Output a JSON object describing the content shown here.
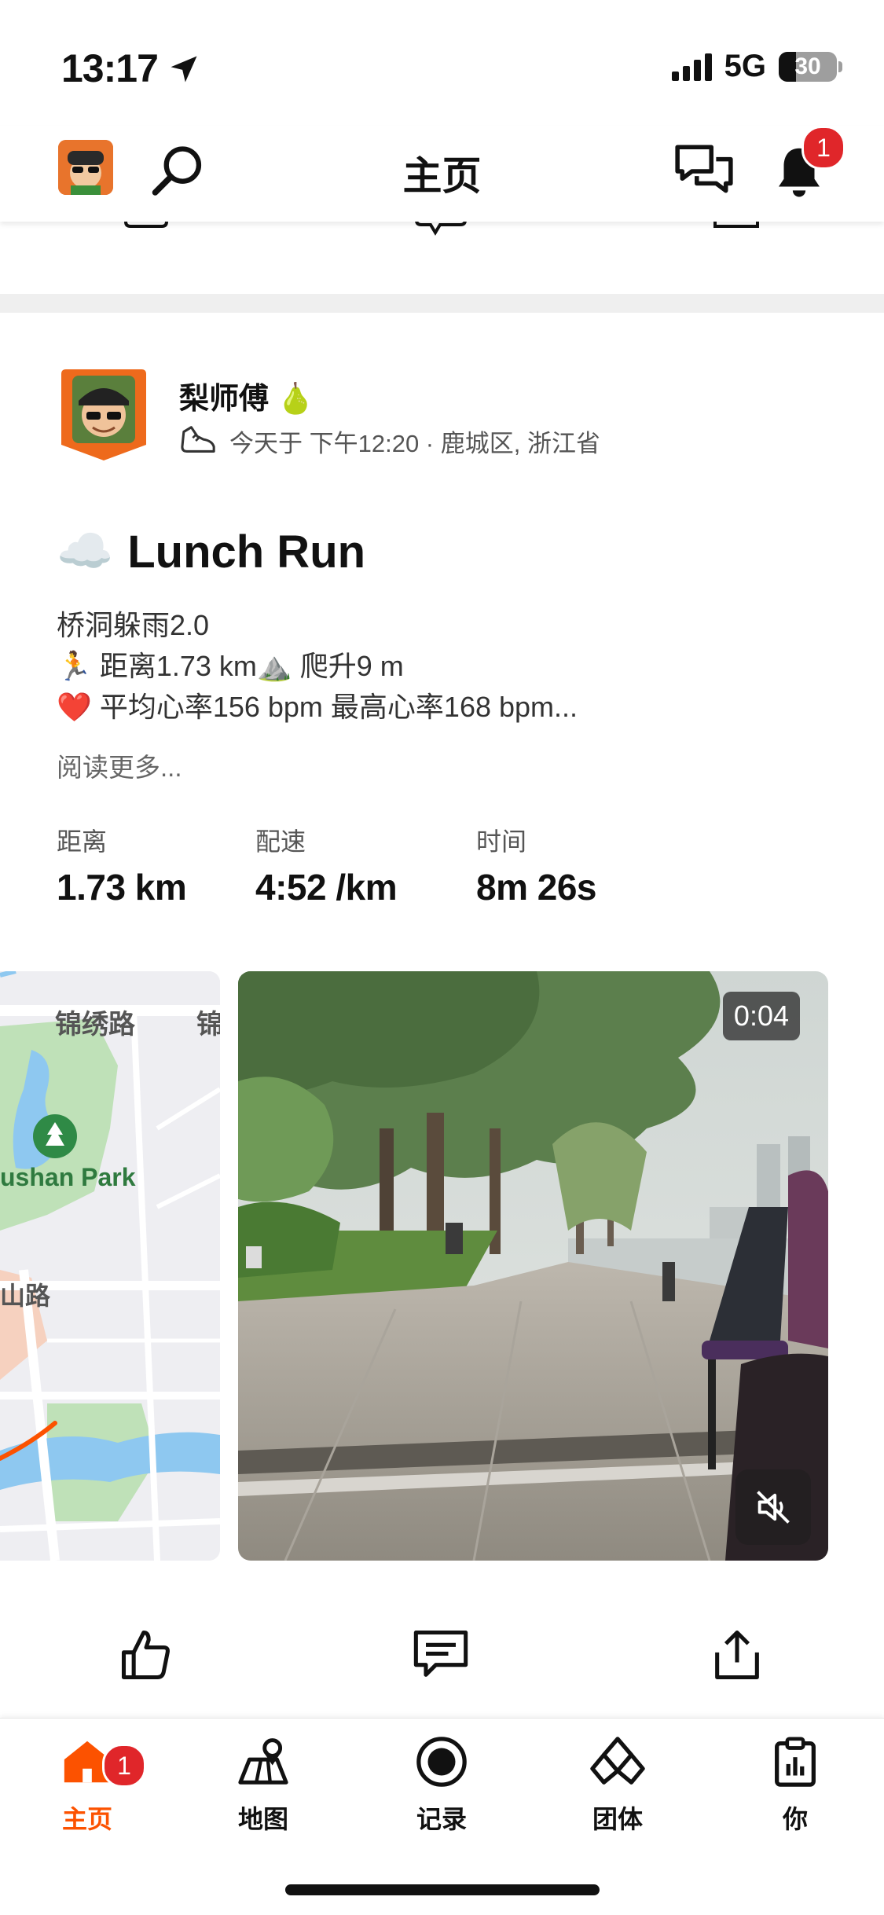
{
  "status_bar": {
    "time": "13:17",
    "network": "5G",
    "battery": "30"
  },
  "header": {
    "title": "主页",
    "notification_count": "1"
  },
  "post": {
    "author": "梨师傅",
    "author_emoji": "🍐",
    "meta": "今天于 下午12:20 · 鹿城区, 浙江省",
    "weather_emoji": "☁️",
    "title": "Lunch Run",
    "description_lines": [
      "桥洞躲雨2.0",
      "🏃 距离1.73 km⛰️ 爬升9 m",
      "❤️ 平均心率156 bpm 最高心率168 bpm..."
    ],
    "read_more": "阅读更多...",
    "stats": [
      {
        "label": "距离",
        "value": "1.73 km"
      },
      {
        "label": "配速",
        "value": "4:52 /km"
      },
      {
        "label": "时间",
        "value": "8m 26s"
      }
    ],
    "map_labels": {
      "road1": "锦绣路",
      "road1b": "锦",
      "park": "ushan Park",
      "road2": "山路"
    },
    "video_duration": "0:04"
  },
  "bottom_nav": {
    "items": [
      {
        "label": "主页",
        "active": true,
        "badge": "1"
      },
      {
        "label": "地图"
      },
      {
        "label": "记录"
      },
      {
        "label": "团体"
      },
      {
        "label": "你"
      }
    ]
  },
  "colors": {
    "accent": "#fc5200",
    "badge": "#e0262a"
  }
}
